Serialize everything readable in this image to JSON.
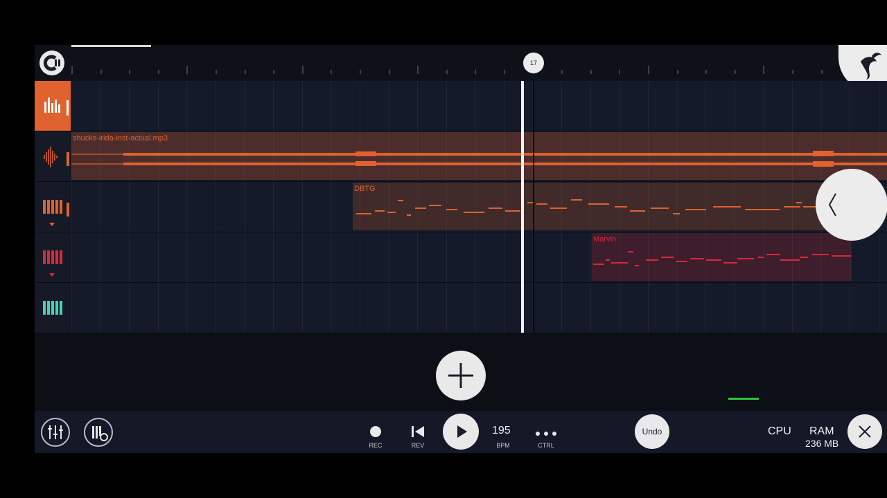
{
  "ruler": {
    "playhead_bar": "17"
  },
  "tracks": [
    {
      "type": "pattern",
      "icon": "bar-chart-icon",
      "active": true
    },
    {
      "type": "audio",
      "icon": "waveform-icon",
      "clip_label": "shucks-irida-inst-actual.mp3",
      "color": "#e0622e"
    },
    {
      "type": "piano",
      "icon": "piano-icon",
      "clip_label": "DBTG",
      "color": "#e0622e"
    },
    {
      "type": "piano",
      "icon": "piano-icon",
      "clip_label": "Marvin",
      "color": "#d8293a"
    },
    {
      "type": "piano",
      "icon": "piano-icon",
      "color": "#3fd6b4"
    }
  ],
  "transport": {
    "rec_label": "REC",
    "rev_label": "REV",
    "tempo_value": "195",
    "tempo_label": "BPM",
    "ctrl_label": "CTRL",
    "undo_label": "Undo"
  },
  "status": {
    "cpu_label": "CPU",
    "ram_label": "RAM",
    "ram_value": "236 MB"
  },
  "colors": {
    "accent": "#e0622e",
    "midi_red": "#d8293a",
    "teal": "#3fd6b4",
    "background": "#0d0f17"
  }
}
